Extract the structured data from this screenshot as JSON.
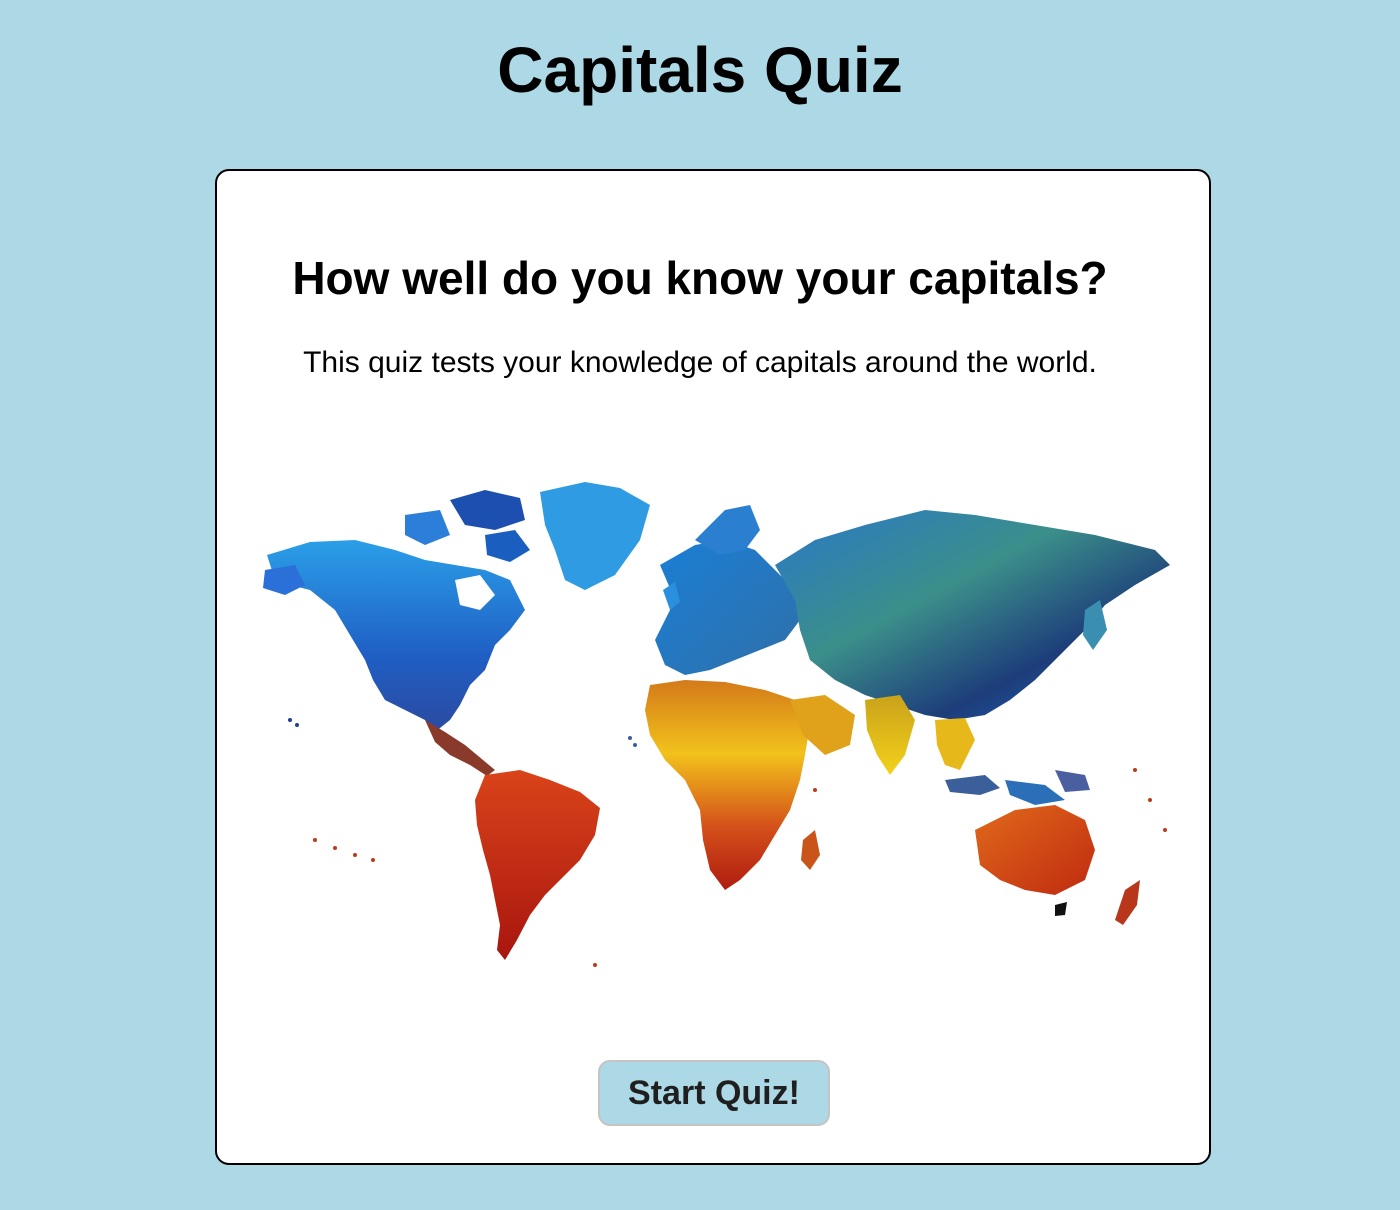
{
  "page": {
    "title": "Capitals Quiz"
  },
  "intro": {
    "heading": "How well do you know your capitals?",
    "description": "This quiz tests your knowledge of capitals around the world."
  },
  "image": {
    "subject": "world-map",
    "colors": [
      "#1e6fd9",
      "#2fa8e6",
      "#f2c21b",
      "#d35400",
      "#b01c10"
    ]
  },
  "actions": {
    "start_label": "Start Quiz!"
  },
  "colors": {
    "background": "#add8e6",
    "card": "#ffffff",
    "button": "#add8e6"
  }
}
